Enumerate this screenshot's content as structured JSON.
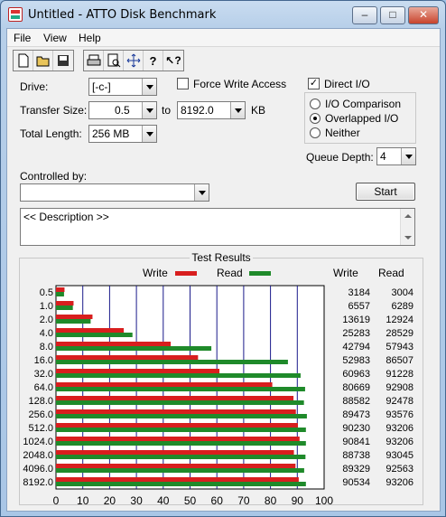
{
  "window": {
    "title": "Untitled - ATTO Disk Benchmark",
    "controls": [
      "–",
      "□",
      "✕"
    ]
  },
  "menu": [
    "File",
    "View",
    "Help"
  ],
  "toolbar": {
    "icons": [
      "new-icon",
      "open-icon",
      "save-icon",
      "print-icon",
      "print-preview-icon",
      "move-icon",
      "help-icon",
      "context-help-icon"
    ]
  },
  "settings": {
    "drive_label": "Drive:",
    "drive_value": "[-c-]",
    "force_write_label": "Force Write Access",
    "direct_io_label": "Direct I/O",
    "direct_io_checked": true,
    "force_write_checked": false,
    "transfer_label": "Transfer Size:",
    "transfer_from": "0.5",
    "to_label": "to",
    "transfer_to": "8192.0",
    "kb_label": "KB",
    "length_label": "Total Length:",
    "length_value": "256 MB",
    "io_options": [
      "I/O Comparison",
      "Overlapped I/O",
      "Neither"
    ],
    "io_selected": "Overlapped I/O",
    "queue_label": "Queue Depth:",
    "queue_value": "4",
    "controlled_label": "Controlled by:",
    "controlled_value": "",
    "start_label": "Start",
    "description": "<< Description >>"
  },
  "results": {
    "title": "Test Results",
    "legend_write": "Write",
    "legend_read": "Read",
    "col_write": "Write",
    "col_read": "Read",
    "write_color": "#d81e1e",
    "read_color": "#1f8a2a"
  },
  "chart_data": {
    "type": "bar",
    "title": "Test Results",
    "categories": [
      "0.5",
      "1.0",
      "2.0",
      "4.0",
      "8.0",
      "16.0",
      "32.0",
      "64.0",
      "128.0",
      "256.0",
      "512.0",
      "1024.0",
      "2048.0",
      "4096.0",
      "8192.0"
    ],
    "series": [
      {
        "name": "Write",
        "values": [
          3184,
          6557,
          13619,
          25283,
          42794,
          52983,
          60963,
          80669,
          88582,
          89473,
          90230,
          90841,
          88738,
          89329,
          90534
        ]
      },
      {
        "name": "Read",
        "values": [
          3004,
          6289,
          12924,
          28529,
          57943,
          86507,
          91228,
          92908,
          92478,
          93576,
          93206,
          93206,
          93045,
          92563,
          93206
        ]
      }
    ],
    "xlim": [
      0,
      100
    ],
    "x_ticks": [
      "0",
      "10",
      "20",
      "30",
      "40",
      "50",
      "60",
      "70",
      "80",
      "90",
      "100"
    ],
    "grid": true
  }
}
